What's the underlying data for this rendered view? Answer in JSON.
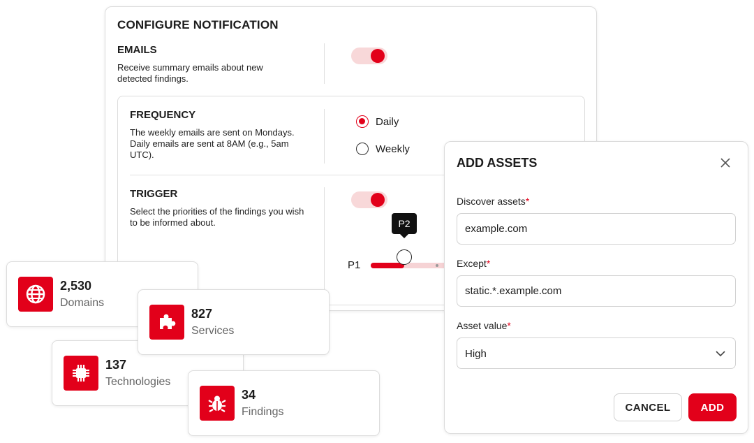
{
  "notification": {
    "title": "CONFIGURE NOTIFICATION",
    "emails": {
      "title": "EMAILS",
      "description": "Receive summary emails about new detected findings.",
      "enabled": true
    },
    "frequency": {
      "title": "FREQUENCY",
      "description": "The weekly emails are sent on Mondays. Daily emails are sent at 8AM (e.g., 5am UTC).",
      "options": [
        "Daily",
        "Weekly"
      ],
      "selected": "Daily"
    },
    "trigger": {
      "title": "TRIGGER",
      "description": "Select the priorities of the findings you wish to be informed about.",
      "enabled": true,
      "slider_min_label": "P1",
      "tooltip": "P2"
    }
  },
  "stats": [
    {
      "value": "2,530",
      "label": "Domains",
      "icon": "globe-icon"
    },
    {
      "value": "827",
      "label": "Services",
      "icon": "puzzle-icon"
    },
    {
      "value": "137",
      "label": "Technologies",
      "icon": "chip-icon"
    },
    {
      "value": "34",
      "label": "Findings",
      "icon": "bug-icon"
    }
  ],
  "add_assets": {
    "title": "ADD ASSETS",
    "discover_label": "Discover assets",
    "discover_value": "example.com",
    "except_label": "Except",
    "except_value": "static.*.example.com",
    "asset_value_label": "Asset value",
    "asset_value_selected": "High",
    "required_mark": "*",
    "cancel_label": "CANCEL",
    "add_label": "ADD"
  },
  "colors": {
    "accent": "#e2001a",
    "accent_light": "#f8d8d9"
  }
}
